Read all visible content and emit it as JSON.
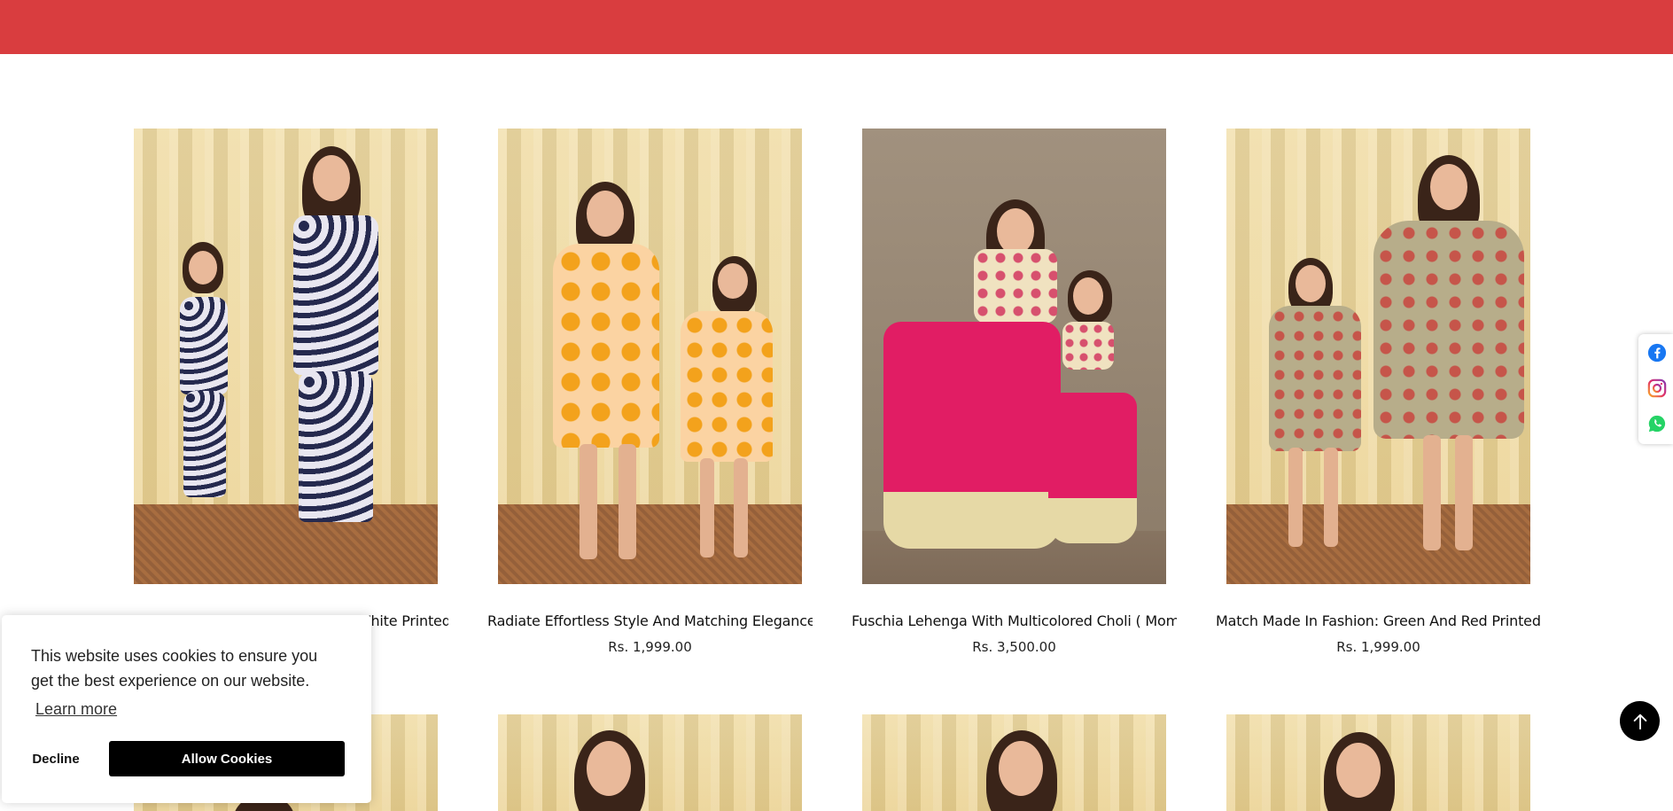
{
  "products": [
    {
      "title": "Match Made In Fashion: Blue And White Printed...",
      "price": ""
    },
    {
      "title": "Radiate Effortless Style And Matching Elegance...",
      "price": "Rs. 1,999.00"
    },
    {
      "title": "Fuschia Lehenga With Multicolored Choli ( Mom ...",
      "price": "Rs. 3,500.00"
    },
    {
      "title": "Match Made In Fashion: Green And Red Printed...",
      "price": "Rs. 1,999.00"
    }
  ],
  "cookie": {
    "message": "This website uses cookies to ensure you get the best experience on our website.",
    "learn_more": "Learn more",
    "decline": "Decline",
    "allow": "Allow Cookies"
  },
  "social": [
    "facebook-icon",
    "instagram-icon",
    "whatsapp-icon"
  ],
  "colors": {
    "topbar": "#d93d3f",
    "button_dark": "#000000"
  }
}
